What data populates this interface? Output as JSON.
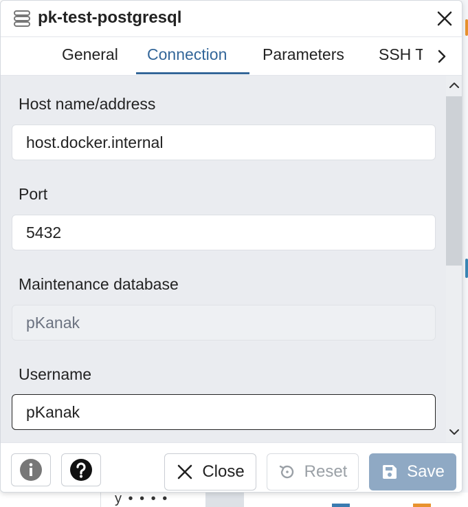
{
  "dialog": {
    "title": "pk-test-postgresql",
    "header_icons": [
      "server-icon",
      "close-icon"
    ]
  },
  "tabs": [
    {
      "label": "General",
      "active": false
    },
    {
      "label": "Connection",
      "active": true
    },
    {
      "label": "Parameters",
      "active": false
    },
    {
      "label": "SSH Tunnel",
      "active": false
    }
  ],
  "fields": {
    "host": {
      "label": "Host name/address",
      "value": "host.docker.internal"
    },
    "port": {
      "label": "Port",
      "value": "5432"
    },
    "maintenance_db": {
      "label": "Maintenance database",
      "value": "pKanak",
      "disabled": true
    },
    "username": {
      "label": "Username",
      "value": "pKanak",
      "focused": true
    }
  },
  "footer": {
    "info_icon": "info-icon",
    "help_icon": "help-icon",
    "close_label": "Close",
    "reset_label": "Reset",
    "save_label": "Save"
  },
  "colors": {
    "accent": "#336699",
    "save_button": "#8fa9c4",
    "content_background": "#eaecf0"
  },
  "background_app": {
    "partial_text": "y • • • •"
  }
}
